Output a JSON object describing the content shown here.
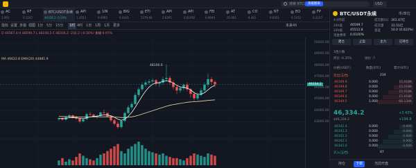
{
  "search": {
    "placeholder": "搜索 BTC/USD"
  },
  "currency": "USD",
  "tickers": [
    {
      "sym": "AC",
      "val": "1.991"
    },
    {
      "sym": "RF",
      "val": "0.1247"
    },
    {
      "sym": "BTC/USDT永续",
      "val": "46334.2 -0.50%"
    },
    {
      "sym": "API",
      "val": "1.4553"
    },
    {
      "sym": "1IN",
      "val": "0.4992"
    },
    {
      "sym": "BIG",
      "val": "0.0441"
    },
    {
      "sym": "ETI",
      "val": "2379.66"
    },
    {
      "sym": "API",
      "val": "2.8391"
    },
    {
      "sym": "API",
      "val": "0.01492"
    },
    {
      "sym": "FEI",
      "val": "0.9944"
    },
    {
      "sym": "AT",
      "val": "25.001"
    },
    {
      "sym": "CO",
      "val": "4.441"
    },
    {
      "sym": "NT",
      "val": "9.6451"
    },
    {
      "sym": "EO",
      "val": "0.7412"
    },
    {
      "sym": "FP",
      "val": "0.2217"
    }
  ],
  "toolbar": {
    "items": [
      "指标",
      "设置",
      "多窗",
      "视图",
      "1分",
      "5分",
      "15分",
      "1时",
      "4时",
      "1日",
      "1周",
      "1月",
      "更多"
    ],
    "right_label": "高级图表",
    "time_label": "未来45"
  },
  "ohlc": {
    "line": "O 46567.4  H 46599.7  L 46146.5  C 46334.2  -232.2 (-0.50%)  振幅 0.97%"
  },
  "ma": {
    "line": "MA 46622.8  EMA(20) 44881.9"
  },
  "chart_data": {
    "type": "candlestick",
    "title": "",
    "ylim": [
      42000,
      50000
    ],
    "y_ticks": [
      50000,
      49000,
      48000,
      47000,
      46000,
      45000,
      44000,
      43000
    ],
    "peak_label": "48100.0",
    "volume_label": "",
    "candles": [
      [
        43250,
        43450,
        43100,
        43350
      ],
      [
        43350,
        43400,
        43150,
        43200
      ],
      [
        43200,
        43500,
        43150,
        43450
      ],
      [
        43450,
        43700,
        43350,
        43600
      ],
      [
        43600,
        43650,
        43300,
        43400
      ],
      [
        43400,
        43550,
        43200,
        43300
      ],
      [
        43300,
        43400,
        42900,
        43050
      ],
      [
        43050,
        43300,
        42950,
        43250
      ],
      [
        43250,
        43800,
        43200,
        43700
      ],
      [
        43700,
        43900,
        43550,
        43650
      ],
      [
        43650,
        43750,
        43400,
        43500
      ],
      [
        43500,
        43650,
        43300,
        43550
      ],
      [
        43550,
        43900,
        43450,
        43850
      ],
      [
        43850,
        44100,
        43700,
        43800
      ],
      [
        43800,
        43850,
        43400,
        43500
      ],
      [
        43500,
        43600,
        43000,
        43150
      ],
      [
        43150,
        43300,
        42700,
        42850
      ],
      [
        42850,
        43050,
        42400,
        42550
      ],
      [
        42550,
        43200,
        42450,
        43100
      ],
      [
        43100,
        43900,
        43000,
        43800
      ],
      [
        43800,
        44500,
        43700,
        44300
      ],
      [
        44300,
        44800,
        44100,
        44600
      ],
      [
        44600,
        45600,
        44500,
        45400
      ],
      [
        45400,
        46100,
        45200,
        45900
      ],
      [
        45900,
        46500,
        45700,
        46300
      ],
      [
        46300,
        46700,
        46100,
        46500
      ],
      [
        46500,
        46800,
        46300,
        46600
      ],
      [
        46600,
        46900,
        46400,
        46700
      ],
      [
        46700,
        46800,
        46200,
        46400
      ],
      [
        46400,
        46600,
        46100,
        46500
      ],
      [
        46500,
        47000,
        46300,
        46800
      ],
      [
        46800,
        48100,
        46600,
        46900
      ],
      [
        46900,
        47100,
        46300,
        46500
      ],
      [
        46500,
        46700,
        45900,
        46100
      ],
      [
        46100,
        46300,
        45500,
        45800
      ],
      [
        45800,
        46200,
        45600,
        46000
      ],
      [
        46000,
        46400,
        45800,
        46300
      ],
      [
        46300,
        46500,
        45700,
        45900
      ],
      [
        45900,
        46000,
        45200,
        45500
      ],
      [
        45500,
        45700,
        44800,
        45100
      ],
      [
        45100,
        45600,
        44900,
        45400
      ],
      [
        45400,
        46000,
        45300,
        45800
      ],
      [
        45800,
        46500,
        45600,
        46300
      ],
      [
        46300,
        47300,
        46100,
        46800
      ],
      [
        46800,
        47000,
        46300,
        46550
      ],
      [
        46550,
        46700,
        46100,
        46334
      ]
    ],
    "volume": [
      0.2,
      0.3,
      0.15,
      0.25,
      0.2,
      0.35,
      0.5,
      0.4,
      0.3,
      0.25,
      0.2,
      0.3,
      0.45,
      0.5,
      0.6,
      0.7,
      0.8,
      0.9,
      0.6,
      0.5,
      0.7,
      0.8,
      0.9,
      1.0,
      0.85,
      0.7,
      0.6,
      0.55,
      0.5,
      0.45,
      0.5,
      0.4,
      0.35,
      0.3,
      0.3,
      0.25,
      0.2,
      0.3,
      0.4,
      0.5,
      0.45,
      0.4,
      0.35,
      0.5,
      0.45,
      0.4
    ],
    "ma_short": [
      43300,
      43320,
      43330,
      43380,
      43400,
      43380,
      43330,
      43300,
      43380,
      43450,
      43500,
      43520,
      43580,
      43640,
      43620,
      43550,
      43420,
      43250,
      43150,
      43250,
      43500,
      43850,
      44300,
      44800,
      45300,
      45750,
      46100,
      46350,
      46450,
      46500,
      46600,
      46650,
      46600,
      46450,
      46250,
      46100,
      46050,
      46000,
      45850,
      45600,
      45450,
      45450,
      45600,
      45850,
      46100,
      46250
    ],
    "ma_long": [
      43500,
      43490,
      43480,
      43470,
      43465,
      43460,
      43450,
      43440,
      43440,
      43445,
      43450,
      43450,
      43455,
      43460,
      43460,
      43455,
      43440,
      43420,
      43400,
      43400,
      43420,
      43460,
      43520,
      43600,
      43700,
      43800,
      43900,
      44000,
      44100,
      44200,
      44300,
      44400,
      44480,
      44550,
      44600,
      44650,
      44700,
      44750,
      44780,
      44800,
      44820,
      44850,
      44880,
      44910,
      44940,
      44960
    ]
  },
  "panel": {
    "title": "BTC/USDT永续",
    "subtitle": "4小时前",
    "currency": "币/单位",
    "stats": [
      {
        "label": "24h高",
        "value": "46599.7"
      },
      {
        "label": "24h低",
        "value": "45512.8"
      },
      {
        "label": "成交额(U)",
        "value": "301.47亿"
      },
      {
        "label": "成交量",
        "value": "31.51亿"
      },
      {
        "label": "资金费率",
        "value": "0.0100%"
      },
      {
        "label": "基差",
        "value": "10.0 (0.022%)"
      }
    ],
    "buttons": [
      "建仓",
      "止盈",
      "主力",
      "已持仓"
    ],
    "depth_label": "1档小数",
    "depth_values": [
      "折价 -0.35%",
      "溢价 -7"
    ],
    "ob_header": [
      "价格(USDT)",
      "数量(BTC)",
      "累计(BTC)"
    ],
    "asks_label": "卖出(五档)",
    "asks_count": "234",
    "asks": [
      {
        "p": "46349.9",
        "q": "0.000",
        "t": "15.018K"
      },
      {
        "p": "46349.8",
        "q": "0.000",
        "t": "15.018K"
      },
      {
        "p": "46349.7",
        "q": "0.000",
        "t": "15.018K"
      },
      {
        "p": "46349.6",
        "q": "0.000",
        "t": "15.018K"
      },
      {
        "p": "46349.5",
        "q": "1.000",
        "t": "68.134K"
      }
    ],
    "mid": {
      "price": "46,334.2",
      "sub": "$46,334.2",
      "pct": "+3.43%",
      "chg": "+194.8"
    },
    "bids": [
      {
        "p": "46342.4",
        "q": "0.000",
        "t": "0.000"
      },
      {
        "p": "46342.3",
        "q": "0.000",
        "t": "0.000"
      },
      {
        "p": "46342.2",
        "q": "0.000",
        "t": "0.000"
      },
      {
        "p": "46342.1",
        "q": "0.000",
        "t": "0.000"
      },
      {
        "p": "46342.0",
        "q": "0.000",
        "t": "0.000"
      }
    ],
    "bids_label": "买入(五档)",
    "bids_count": "87",
    "tabs": [
      "持仓",
      "下单",
      "当前开盘"
    ],
    "colors": {
      "up": "#26a69a",
      "down": "#ef5350",
      "accent": "#2962ff"
    }
  }
}
